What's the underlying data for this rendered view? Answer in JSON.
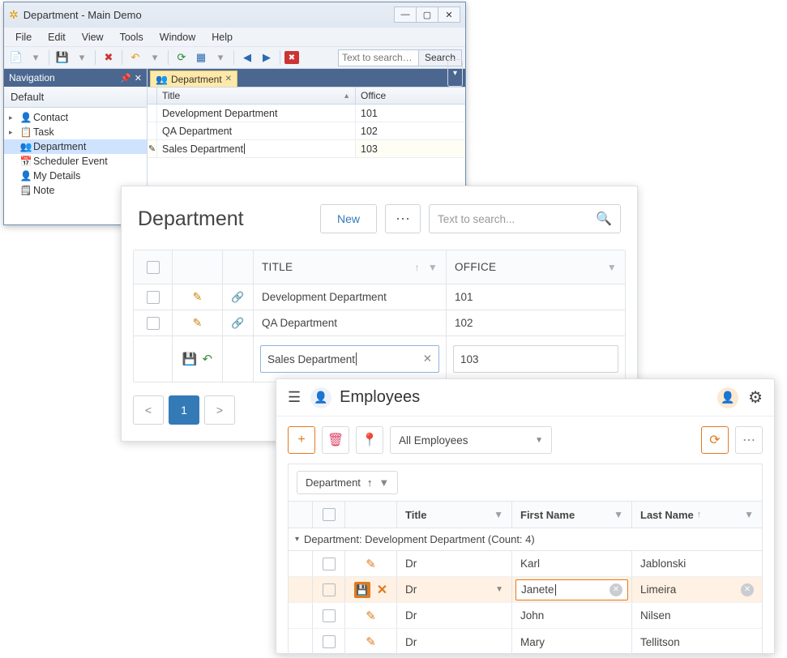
{
  "win1": {
    "title": "Department - Main Demo",
    "menu": [
      "File",
      "Edit",
      "View",
      "Tools",
      "Window",
      "Help"
    ],
    "search_placeholder": "Text to search…",
    "search_button": "Search",
    "nav_header": "Navigation",
    "nav_group": "Default",
    "nav_items": [
      {
        "label": "Contact",
        "icon": "👤",
        "expandable": true
      },
      {
        "label": "Task",
        "icon": "📋",
        "expandable": true
      },
      {
        "label": "Department",
        "icon": "👥",
        "active": true
      },
      {
        "label": "Scheduler Event",
        "icon": "📅"
      },
      {
        "label": "My Details",
        "icon": "👤"
      },
      {
        "label": "Note",
        "icon": "🗒"
      }
    ],
    "tab_label": "Department",
    "columns": {
      "title": "Title",
      "office": "Office"
    },
    "rows": [
      {
        "title": "Development Department",
        "office": "101"
      },
      {
        "title": "QA Department",
        "office": "102"
      },
      {
        "title": "Sales Department",
        "office": "103",
        "editing": true
      }
    ]
  },
  "win2": {
    "title": "Department",
    "new_label": "New",
    "search_placeholder": "Text to search...",
    "columns": {
      "title": "TITLE",
      "office": "OFFICE"
    },
    "rows": [
      {
        "title": "Development Department",
        "office": "101"
      },
      {
        "title": "QA Department",
        "office": "102"
      },
      {
        "title": "Sales Department",
        "office": "103",
        "editing": true
      }
    ],
    "page": "1"
  },
  "win3": {
    "title": "Employees",
    "filter_dropdown": "All Employees",
    "group_chip": "Department",
    "columns": {
      "title": "Title",
      "first": "First Name",
      "last": "Last Name"
    },
    "group_label": "Department: Development Department (Count: 4)",
    "rows": [
      {
        "title": "Dr",
        "first": "Karl",
        "last": "Jablonski"
      },
      {
        "title": "Dr",
        "first": "Janete",
        "last": "Limeira",
        "editing": true
      },
      {
        "title": "Dr",
        "first": "John",
        "last": "Nilsen"
      },
      {
        "title": "Dr",
        "first": "Mary",
        "last": "Tellitson"
      }
    ]
  }
}
